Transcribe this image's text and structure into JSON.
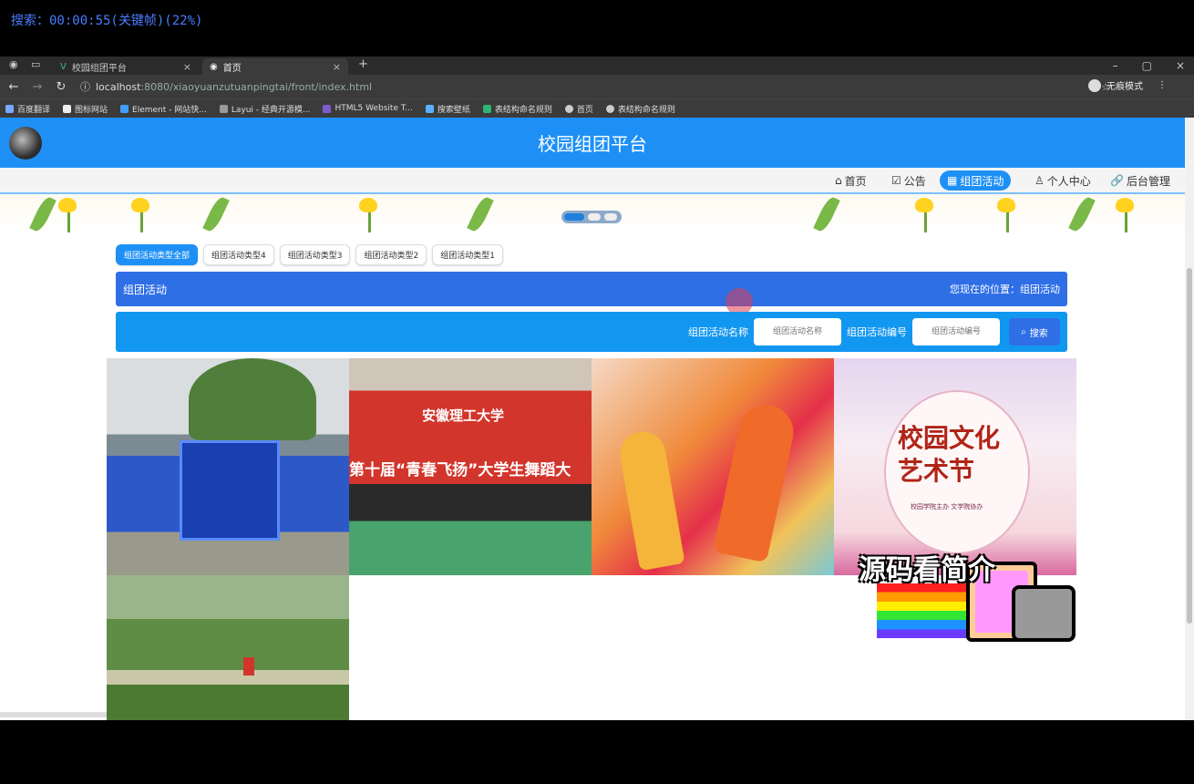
{
  "overlay": {
    "search_status": "搜索：00:00:55(关键帧)(22%)",
    "promo": "源码看简介"
  },
  "browser": {
    "tabs": [
      {
        "label": "校园组团平台",
        "close": "×"
      },
      {
        "label": "首页",
        "close": "×"
      }
    ],
    "new_tab": "+",
    "window_controls": [
      "–",
      "▢",
      "×"
    ],
    "url_host": "localhost",
    "url_rest": ":8080/xiaoyuanzutuanpingtai/front/index.html",
    "incognito": "无痕模式",
    "bookmarks": [
      "百度翻译",
      "图标网站",
      "Element - 网站快...",
      "Layui - 经典开源模...",
      "HTML5 Website T...",
      "搜索壁纸",
      "表结构命名规则",
      "首页",
      "表结构命名规则"
    ]
  },
  "header": {
    "title": "校园组团平台"
  },
  "nav": {
    "items": [
      {
        "icon": "⌂",
        "label": "首页"
      },
      {
        "icon": "☑",
        "label": "公告"
      },
      {
        "icon": "▦",
        "label": "组团活动"
      },
      {
        "icon": "♙",
        "label": "个人中心"
      },
      {
        "icon": "🔗",
        "label": "后台管理"
      }
    ],
    "active_index": 2
  },
  "type_tabs": [
    "组团活动类型全部",
    "组团活动类型4",
    "组团活动类型3",
    "组团活动类型2",
    "组团活动类型1"
  ],
  "breadcrumb": {
    "title": "组团活动",
    "location": "您现在的位置：组团活动"
  },
  "search": {
    "name_label": "组团活动名称",
    "name_placeholder": "组团活动名称",
    "code_label": "组团活动编号",
    "code_placeholder": "组团活动编号",
    "button": "搜索"
  },
  "cards": {
    "c2_school": "安徽理工大学",
    "c2_banner": "第十届“青春飞扬”大学生舞蹈大",
    "c4_title_1": "校园文化",
    "c4_title_2": "艺术节",
    "c4_sub": "校园学院主办 文学院协办"
  },
  "colors": {
    "primary": "#1e90f5",
    "crumb": "#2f6fe6"
  }
}
